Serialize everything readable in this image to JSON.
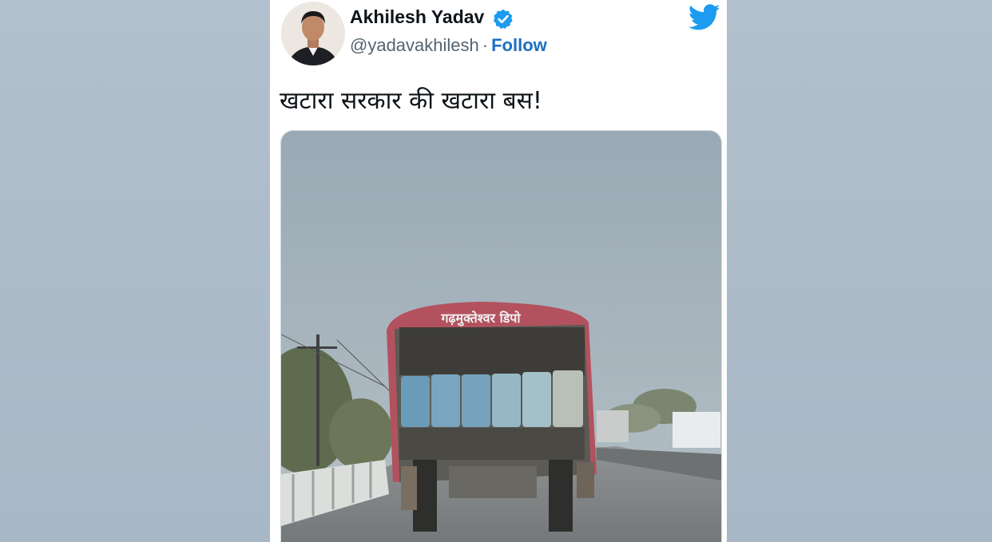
{
  "tweet": {
    "author_name": "Akhilesh Yadav",
    "handle": "@yadavakhilesh",
    "separator": "·",
    "follow_label": "Follow",
    "text": "खटारा सरकार की खटारा बस!",
    "verified": true,
    "media": {
      "bus_sign_text": "गढ़मुक्तेश्वर डिपो"
    }
  },
  "icons": {
    "brand": "twitter-bird-icon",
    "verified": "verified-badge-icon"
  },
  "colors": {
    "brand_blue": "#1d9bf0",
    "follow_link": "#1b6fc2",
    "background": "#a9b8c6"
  }
}
